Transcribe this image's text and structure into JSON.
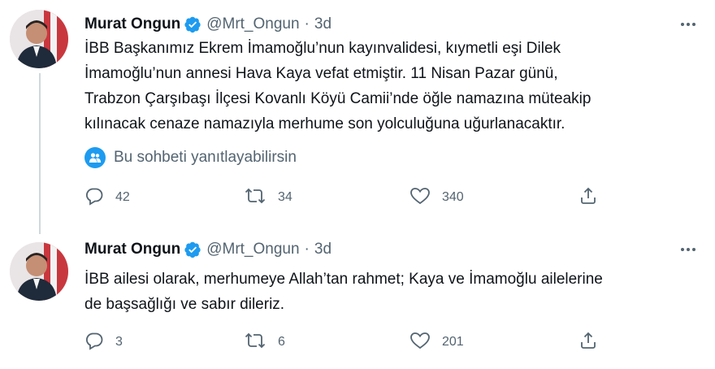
{
  "tweets": [
    {
      "author_name": "Murat Ongun",
      "handle": "@Mrt_Ongun",
      "separator": "·",
      "time": "3d",
      "text_lines": [
        "İBB Başkanımız Ekrem İmamoğlu’nun kayınvalidesi, kıymetli eşi Dilek",
        "İmamoğlu’nun annesi Hava Kaya vefat etmiştir. 11 Nisan Pazar günü,",
        "Trabzon Çarşıbaşı İlçesi Kovanlı Köyü Camii’nde öğle namazına müteakip",
        "kılınacak cenaze namazıyla merhume son yolculuğuna uğurlanacaktır."
      ],
      "reply_note": "Bu sohbeti yanıtlayabilirsin",
      "replies": "42",
      "retweets": "34",
      "likes": "340"
    },
    {
      "author_name": "Murat Ongun",
      "handle": "@Mrt_Ongun",
      "separator": "·",
      "time": "3d",
      "text_lines": [
        "İBB ailesi olarak, merhumeye Allah’tan rahmet; Kaya ve İmamoğlu ailelerine",
        "de başsağlığı ve sabır dileriz."
      ],
      "replies": "3",
      "retweets": "6",
      "likes": "201"
    }
  ],
  "icons": {
    "verified": "verified-badge-icon",
    "more": "more-dots-icon",
    "reply": "reply-bubble-icon",
    "retweet": "retweet-icon",
    "like": "heart-icon",
    "share": "share-upload-icon",
    "conversation": "people-icon"
  },
  "colors": {
    "accent": "#1d9bf0",
    "text_primary": "#0f1419",
    "text_secondary": "#536471",
    "thread_line": "#cfd9de"
  }
}
